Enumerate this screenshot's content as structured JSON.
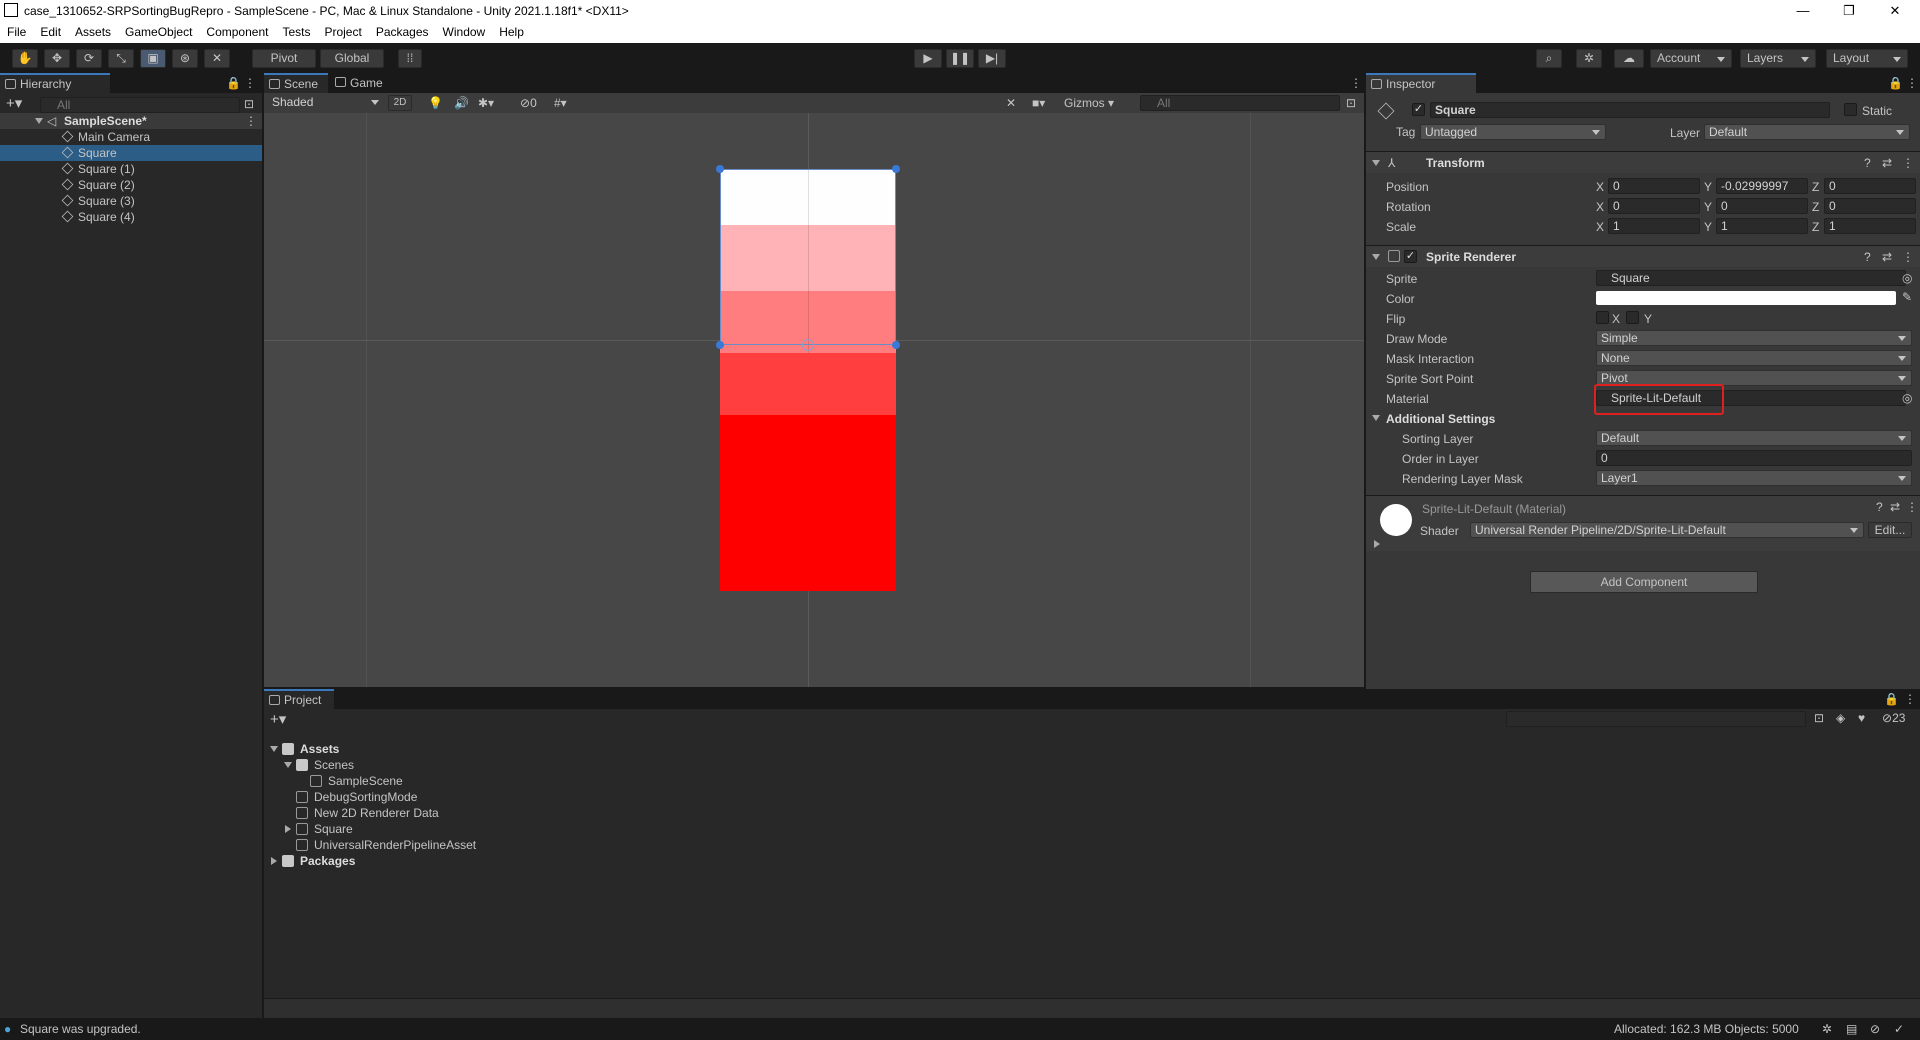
{
  "window": {
    "title": "case_1310652-SRPSortingBugRepro - SampleScene - PC, Mac & Linux Standalone - Unity 2021.1.18f1* <DX11>",
    "min": "—",
    "max": "❐",
    "close": "✕"
  },
  "menu": [
    "File",
    "Edit",
    "Assets",
    "GameObject",
    "Component",
    "Tests",
    "Project",
    "Packages",
    "Window",
    "Help"
  ],
  "toolbar": {
    "pivot": "Pivot",
    "global": "Global",
    "account": "Account",
    "layers": "Layers",
    "layout": "Layout"
  },
  "hierarchy": {
    "tab": "Hierarchy",
    "search": "All",
    "scene": "SampleScene*",
    "items": [
      "Main Camera",
      "Square",
      "Square (1)",
      "Square (2)",
      "Square (3)",
      "Square (4)"
    ],
    "selected": 1
  },
  "scene": {
    "tab_scene": "Scene",
    "tab_game": "Game",
    "shading": "Shaded",
    "mode2d": "2D",
    "fx_count": "0",
    "gizmos": "Gizmos",
    "search": "All",
    "colors": [
      "#fefefe",
      "#ffb3b6",
      "#ff7d7f",
      "#ff3e3f",
      "#ff0000"
    ]
  },
  "inspector": {
    "tab": "Inspector",
    "object_name": "Square",
    "static": "Static",
    "tag_label": "Tag",
    "tag": "Untagged",
    "layer_label": "Layer",
    "layer": "Default",
    "transform": {
      "title": "Transform",
      "position": {
        "label": "Position",
        "x": "0",
        "y": "-0.02999997",
        "z": "0"
      },
      "rotation": {
        "label": "Rotation",
        "x": "0",
        "y": "0",
        "z": "0"
      },
      "scale": {
        "label": "Scale",
        "x": "1",
        "y": "1",
        "z": "1"
      }
    },
    "sprite_renderer": {
      "title": "Sprite Renderer",
      "sprite_label": "Sprite",
      "sprite": "Square",
      "color_label": "Color",
      "color": "#ffffff",
      "flip_label": "Flip",
      "flip_x": "X",
      "flip_y": "Y",
      "draw_mode_label": "Draw Mode",
      "draw_mode": "Simple",
      "mask_label": "Mask Interaction",
      "mask": "None",
      "sort_point_label": "Sprite Sort Point",
      "sort_point": "Pivot",
      "material_label": "Material",
      "material": "Sprite-Lit-Default",
      "additional": "Additional Settings",
      "sorting_layer_label": "Sorting Layer",
      "sorting_layer": "Default",
      "order_label": "Order in Layer",
      "order": "0",
      "render_mask_label": "Rendering Layer Mask",
      "render_mask": "Layer1"
    },
    "material": {
      "title": "Sprite-Lit-Default (Material)",
      "shader_label": "Shader",
      "shader": "Universal Render Pipeline/2D/Sprite-Lit-Default",
      "edit": "Edit..."
    },
    "add_component": "Add Component",
    "highlight_color": "#e02020"
  },
  "project": {
    "tab": "Project",
    "count": "23",
    "tree": [
      {
        "label": "Assets"
      },
      {
        "label": "Scenes"
      },
      {
        "label": "SampleScene"
      },
      {
        "label": "DebugSortingMode"
      },
      {
        "label": "New 2D Renderer Data"
      },
      {
        "label": "Square"
      },
      {
        "label": "UniversalRenderPipelineAsset"
      },
      {
        "label": "Packages"
      }
    ]
  },
  "status": {
    "message": "Square was upgraded.",
    "stats": "Allocated: 162.3 MB Objects: 5000"
  }
}
